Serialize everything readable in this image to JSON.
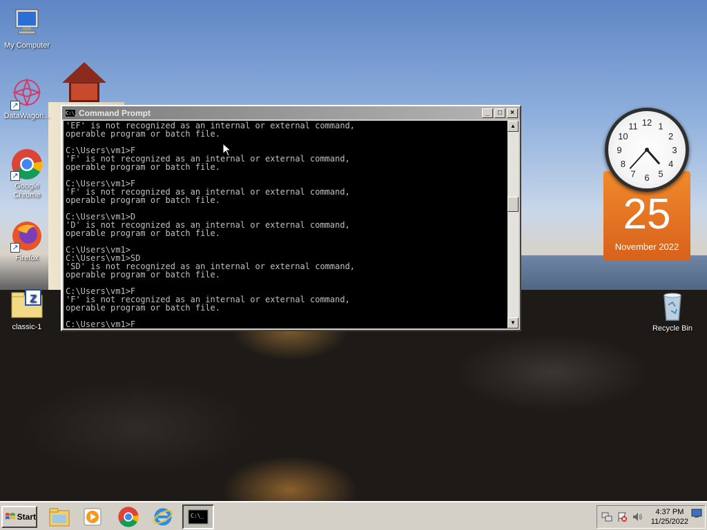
{
  "desktop": {
    "icons": [
      {
        "label": "My Computer",
        "icon": "computer-icon"
      },
      {
        "label": "DataWagon...",
        "icon": "datawagon-icon"
      },
      {
        "label": "Google Chrome",
        "icon": "chrome-icon"
      },
      {
        "label": "Firefox",
        "icon": "firefox-icon"
      },
      {
        "label": "classic-1",
        "icon": "zip-folder-icon"
      },
      {
        "label": "Recycle Bin",
        "icon": "recycle-bin-icon"
      }
    ]
  },
  "cmd": {
    "title": "Command Prompt",
    "title_icon_text": "C:\\_",
    "lines": [
      "'EF' is not recognized as an internal or external command,",
      "operable program or batch file.",
      "",
      "C:\\Users\\vm1>F",
      "'F' is not recognized as an internal or external command,",
      "operable program or batch file.",
      "",
      "C:\\Users\\vm1>F",
      "'F' is not recognized as an internal or external command,",
      "operable program or batch file.",
      "",
      "C:\\Users\\vm1>D",
      "'D' is not recognized as an internal or external command,",
      "operable program or batch file.",
      "",
      "C:\\Users\\vm1>",
      "C:\\Users\\vm1>SD",
      "'SD' is not recognized as an internal or external command,",
      "operable program or batch file.",
      "",
      "C:\\Users\\vm1>F",
      "'F' is not recognized as an internal or external command,",
      "operable program or batch file.",
      "",
      "C:\\Users\\vm1>F"
    ]
  },
  "gadget": {
    "day": "25",
    "month_year": "November 2022",
    "clock_numbers": [
      "12",
      "1",
      "2",
      "3",
      "4",
      "5",
      "6",
      "7",
      "8",
      "9",
      "10",
      "11"
    ],
    "hour": 4,
    "minute": 37
  },
  "taskbar": {
    "start_label": "Start",
    "apps": [
      "file-explorer-icon",
      "media-player-icon",
      "chrome-icon",
      "internet-explorer-icon",
      "command-prompt-icon"
    ],
    "time": "4:37 PM",
    "date": "11/25/2022"
  }
}
